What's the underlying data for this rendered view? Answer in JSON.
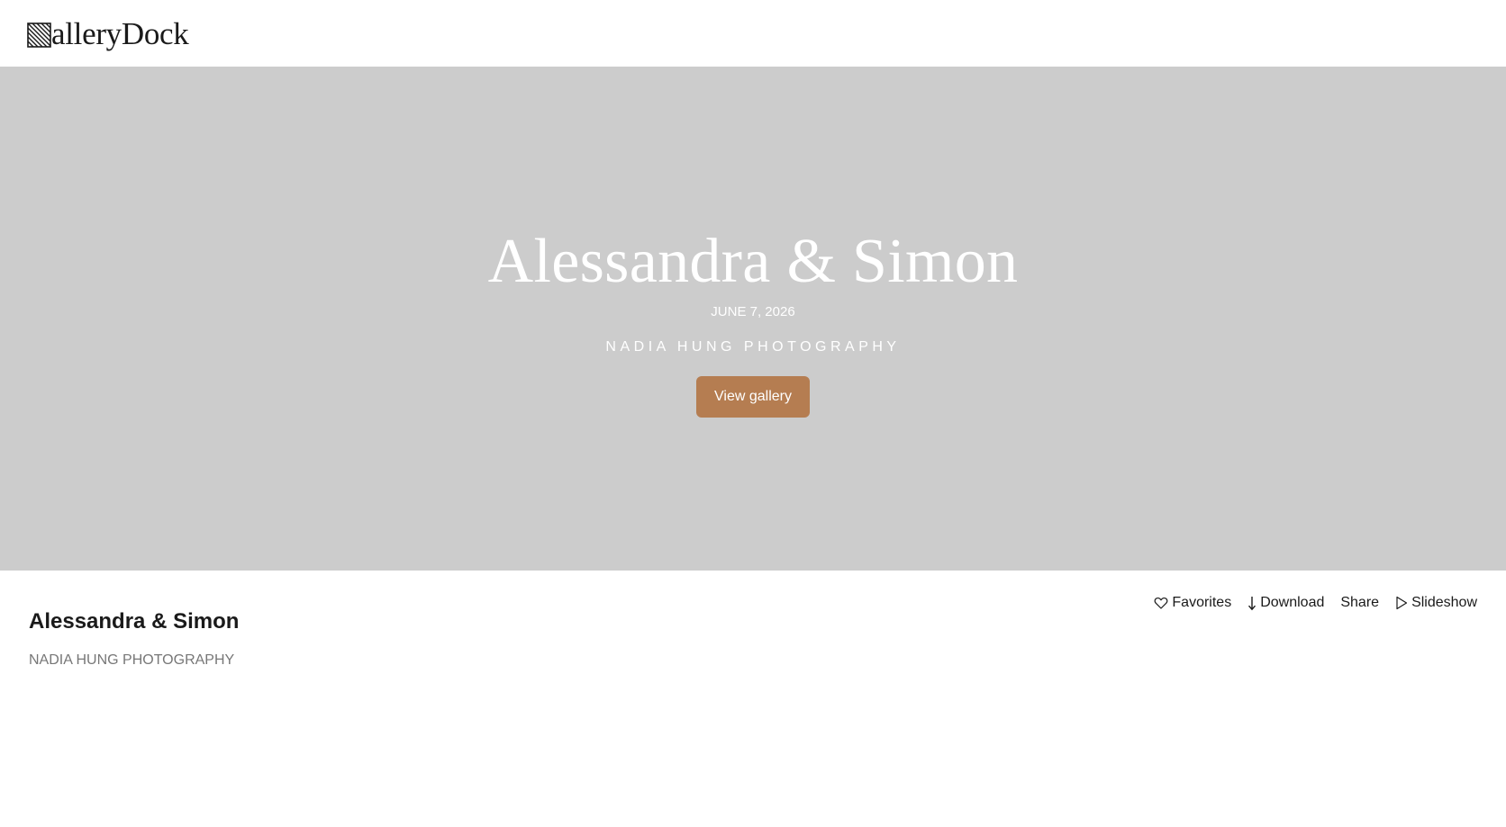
{
  "header": {
    "logo_text": "alleryDock",
    "logo_icon": "striped-g-logo-icon"
  },
  "hero": {
    "title": "Alessandra & Simon",
    "date": "JUNE 7, 2026",
    "photographer": "NADIA HUNG PHOTOGRAPHY",
    "button_label": "View gallery"
  },
  "info": {
    "title": "Alessandra & Simon",
    "photographer": "NADIA HUNG PHOTOGRAPHY"
  },
  "actions": {
    "favorites": {
      "label": "Favorites",
      "icon": "heart-icon"
    },
    "download": {
      "label": "Download",
      "icon": "arrow-down-icon"
    },
    "share": {
      "label": "Share"
    },
    "slideshow": {
      "label": "Slideshow",
      "icon": "play-icon"
    }
  },
  "colors": {
    "hero_background": "#cccccc",
    "accent_button": "#b57d51",
    "text_primary": "#1a1a1a",
    "text_muted": "#777777"
  }
}
